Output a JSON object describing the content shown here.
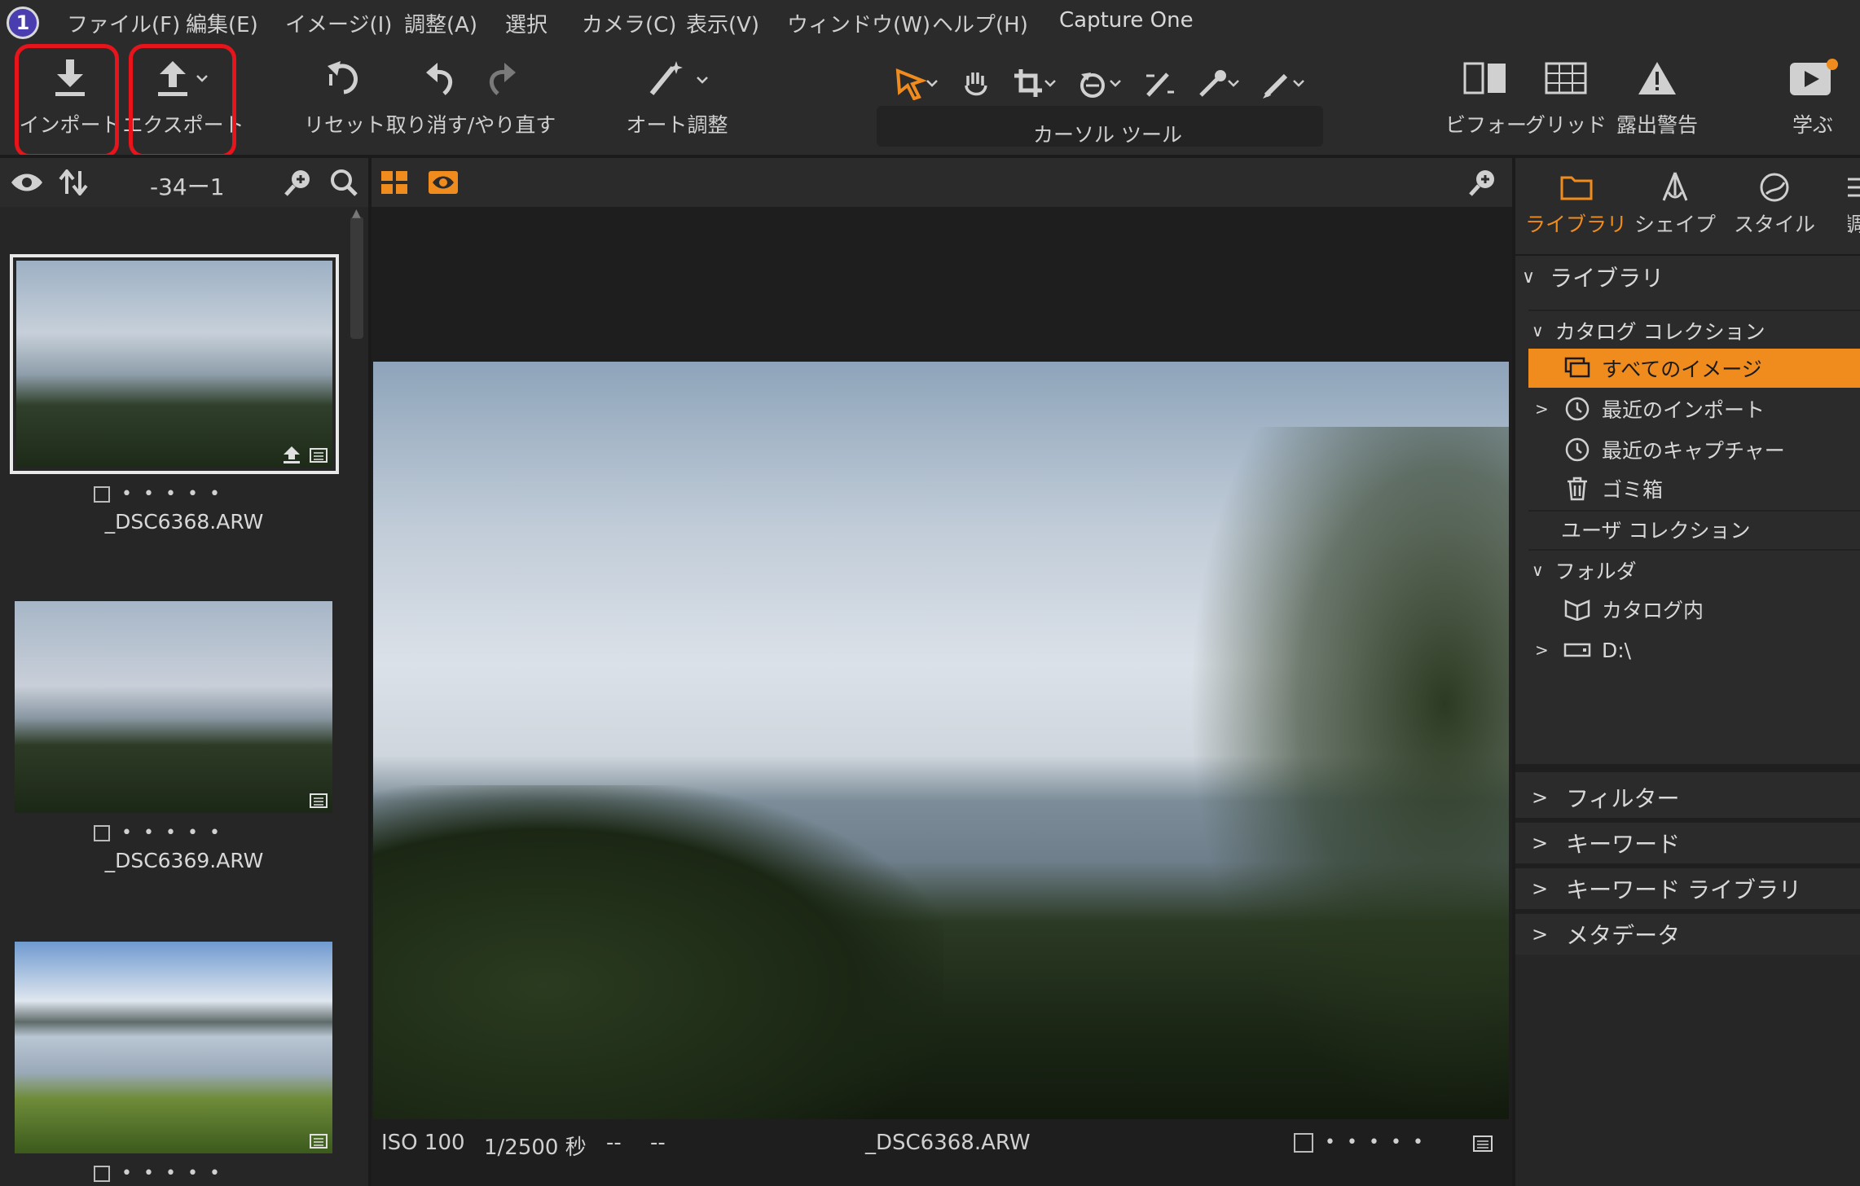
{
  "menu": {
    "app_title": "Capture One",
    "items": [
      "ファイル(F)",
      "編集(E)",
      "イメージ(I)",
      "調整(A)",
      "選択",
      "カメラ(C)",
      "表示(V)",
      "ウィンドウ(W)",
      "ヘルプ(H)"
    ]
  },
  "toolbar": {
    "import": "インポート",
    "export": "エクスポート",
    "reset": "リセット",
    "undo_redo": "取り消す/やり直す",
    "auto_adjust": "オート調整",
    "cursor_tools": "カーソル ツール",
    "before": "ビフォー",
    "grid": "グリッド",
    "exposure_warning": "露出警告",
    "learn": "学ぶ"
  },
  "colors": {
    "accent": "#f08c1e",
    "highlight_box": "#e8141c"
  },
  "browser": {
    "count_label": "-34ー1"
  },
  "thumbnails": [
    {
      "filename": "_DSC6368.ARW",
      "selected": true
    },
    {
      "filename": "_DSC6369.ARW",
      "selected": false
    },
    {
      "filename": "",
      "selected": false
    }
  ],
  "viewer": {
    "iso": "ISO 100",
    "shutter": "1/2500 秒",
    "aperture": "--",
    "focal": "--",
    "filename": "_DSC6368.ARW"
  },
  "panel": {
    "tabs": [
      "ライブラリ",
      "シェイプ",
      "スタイル",
      "調"
    ],
    "library_header": "ライブラリ",
    "catalog_collection": "カタログ コレクション",
    "all_images": "すべてのイメージ",
    "recent_imports": "最近のインポート",
    "recent_captures": "最近のキャプチャー",
    "trash": "ゴミ箱",
    "user_collection": "ユーザ コレクション",
    "folders": "フォルダ",
    "in_catalog": "カタログ内",
    "drive": "D:\\",
    "sections": [
      "フィルター",
      "キーワード",
      "キーワード ライブラリ",
      "メタデータ"
    ]
  }
}
